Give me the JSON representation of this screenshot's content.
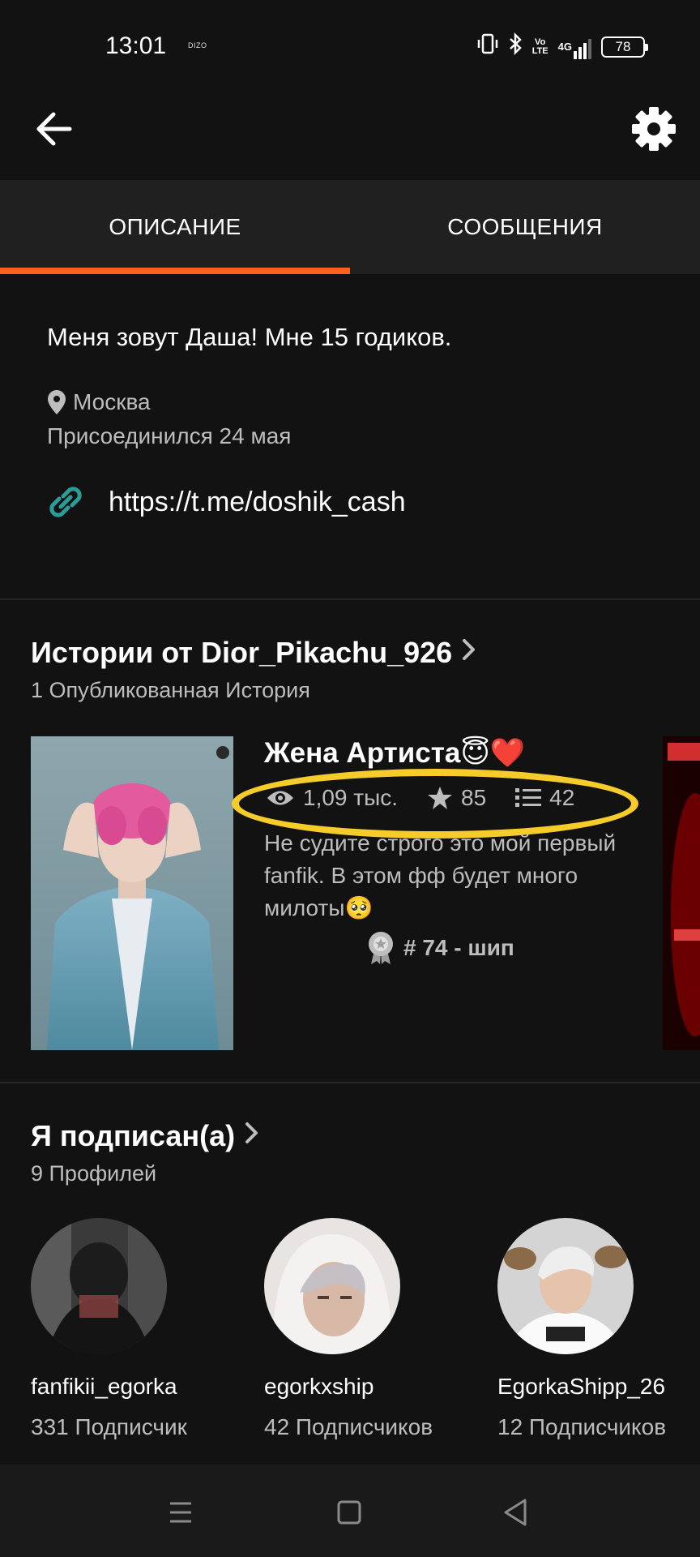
{
  "status_bar": {
    "time": "13:01",
    "carrier": "DIZO",
    "lte": "Vo\nLTE",
    "network": "4G",
    "battery": "78"
  },
  "app_bar": {
    "back_icon": "arrow-left-icon",
    "settings_icon": "gear-icon"
  },
  "tabs": [
    {
      "label": "ОПИСАНИЕ",
      "active": true
    },
    {
      "label": "СООБЩЕНИЯ",
      "active": false
    }
  ],
  "about": {
    "bio": "Меня зовут Даша! Мне 15 годиков.",
    "location": "Москва",
    "joined": "Присоединился 24 мая",
    "link": "https://t.me/doshik_cash"
  },
  "stories": {
    "title": "Истории от Dior_Pikachu_926",
    "subtitle": "1 Опубликованная История",
    "items": [
      {
        "title": "Жена Артиста😇❤️",
        "views": "1,09 тыс.",
        "votes": "85",
        "parts": "42",
        "description": "Не судите строго это мой первый fanfik. В этом фф будет много милоты🥺",
        "rank": "# 74 - шип"
      }
    ]
  },
  "following": {
    "title": "Я подписан(а)",
    "subtitle": "9 Профилей",
    "profiles": [
      {
        "name": "fanfikii_egorka",
        "followers": "331 Подписчик"
      },
      {
        "name": "egorkxship",
        "followers": "42 Подписчиков"
      },
      {
        "name": "EgorkaShipp_26",
        "followers": "12 Подписчиков"
      }
    ]
  },
  "colors": {
    "accent": "#ff6122",
    "highlight": "#f5cc2a",
    "background": "#121212",
    "link_icon": "#2a9d9a"
  }
}
